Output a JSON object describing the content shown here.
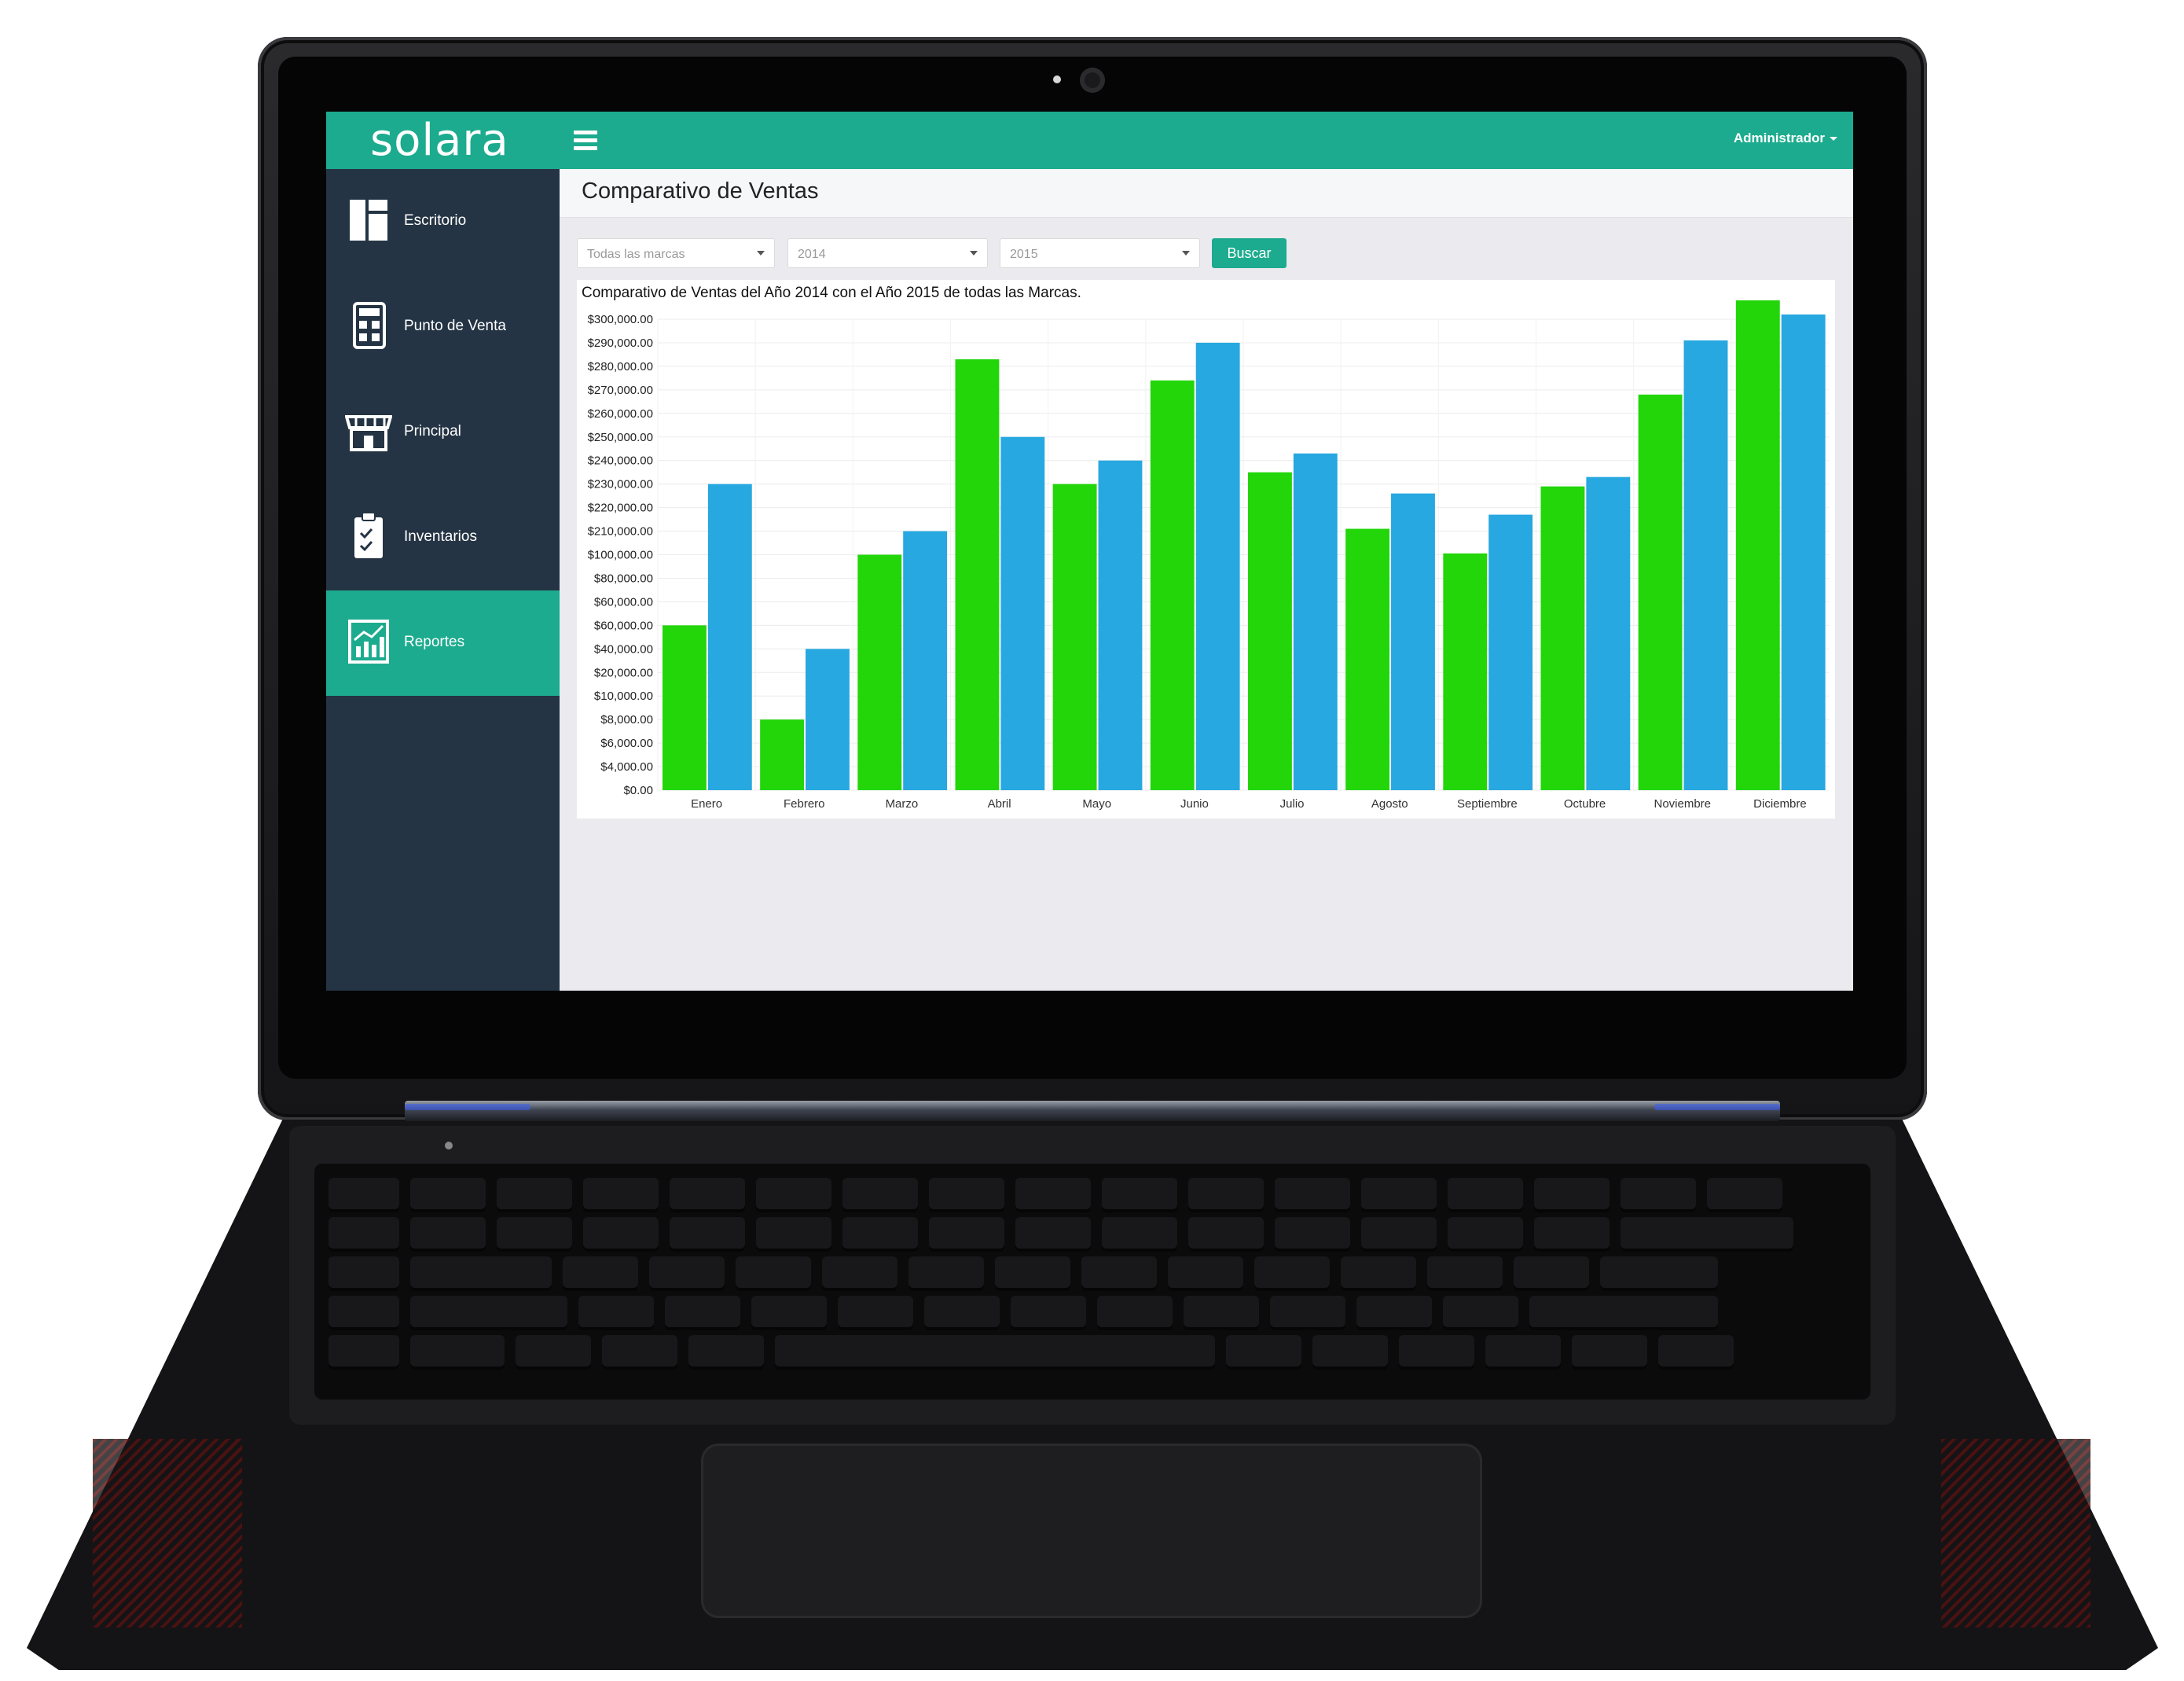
{
  "app": {
    "logo": "solara",
    "user_menu": "Administrador"
  },
  "sidebar": {
    "items": [
      {
        "label": "Escritorio",
        "icon": "dashboard-icon"
      },
      {
        "label": "Punto de Venta",
        "icon": "calculator-icon"
      },
      {
        "label": "Principal",
        "icon": "storefront-icon"
      },
      {
        "label": "Inventarios",
        "icon": "clipboard-check-icon"
      },
      {
        "label": "Reportes",
        "icon": "chart-report-icon",
        "active": true
      }
    ]
  },
  "page": {
    "title": "Comparativo de Ventas"
  },
  "filters": {
    "brand": "Todas las marcas",
    "year_a": "2014",
    "year_b": "2015",
    "search_label": "Buscar"
  },
  "colors": {
    "accent": "#1cab8e",
    "sidebar_bg": "#243444",
    "series_2014": "#22d60a",
    "series_2015": "#27a8e0"
  },
  "chart_data": {
    "type": "bar",
    "title": "Comparativo de Ventas del Año 2014 con el Año 2015 de todas las Marcas.",
    "categories": [
      "Enero",
      "Febrero",
      "Marzo",
      "Abril",
      "Mayo",
      "Junio",
      "Julio",
      "Agosto",
      "Septiembre",
      "Octubre",
      "Noviembre",
      "Diciembre"
    ],
    "y_ticks": [
      "$300,000.00",
      "$290,000.00",
      "$280,000.00",
      "$270,000.00",
      "$260,000.00",
      "$250,000.00",
      "$240,000.00",
      "$230,000.00",
      "$220,000.00",
      "$210,000.00",
      "$100,000.00",
      "$80,000.00",
      "$60,000.00",
      "$60,000.00",
      "$40,000.00",
      "$20,000.00",
      "$10,000.00",
      "$8,000.00",
      "$6,000.00",
      "$4,000.00",
      "$0.00"
    ],
    "series": [
      {
        "values": [
          60000,
          8000,
          100000,
          283000,
          230000,
          274000,
          235000,
          211000,
          106000,
          229000,
          268000,
          308000
        ]
      },
      {
        "values": [
          230000,
          40000,
          210000,
          250000,
          240000,
          290000,
          243000,
          226000,
          217000,
          233000,
          291000,
          302000
        ]
      }
    ],
    "grid": true,
    "legend": "none"
  }
}
